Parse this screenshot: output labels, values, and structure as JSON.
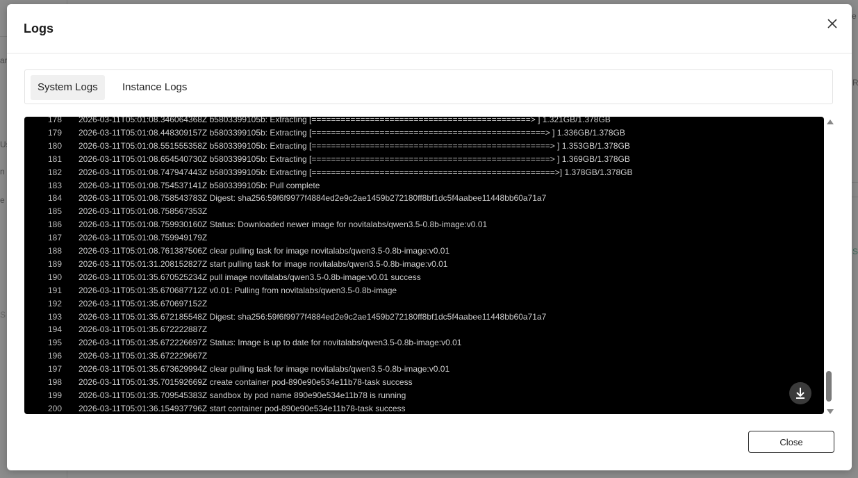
{
  "modal": {
    "title": "Logs",
    "close_icon": "close-icon"
  },
  "tabs": [
    {
      "label": "System Logs",
      "active": true
    },
    {
      "label": "Instance Logs",
      "active": false
    }
  ],
  "logs": [
    {
      "num": "178",
      "text": "2026-03-11T05:01:08.346064368Z b5803399105b: Extracting [=============================================> ] 1.321GB/1.378GB"
    },
    {
      "num": "179",
      "text": "2026-03-11T05:01:08.448309157Z b5803399105b: Extracting [================================================> ] 1.336GB/1.378GB"
    },
    {
      "num": "180",
      "text": "2026-03-11T05:01:08.551555358Z b5803399105b: Extracting [=================================================> ] 1.353GB/1.378GB"
    },
    {
      "num": "181",
      "text": "2026-03-11T05:01:08.654540730Z b5803399105b: Extracting [=================================================> ] 1.369GB/1.378GB"
    },
    {
      "num": "182",
      "text": "2026-03-11T05:01:08.747947443Z b5803399105b: Extracting [==================================================>] 1.378GB/1.378GB"
    },
    {
      "num": "183",
      "text": "2026-03-11T05:01:08.754537141Z b5803399105b: Pull complete"
    },
    {
      "num": "184",
      "text": "2026-03-11T05:01:08.758543783Z Digest: sha256:59f6f9977f4884ed2e9c2ae1459b272180ff8bf1dc5f4aabee11448bb60a71a7"
    },
    {
      "num": "185",
      "text": "2026-03-11T05:01:08.758567353Z"
    },
    {
      "num": "186",
      "text": "2026-03-11T05:01:08.759930160Z Status: Downloaded newer image for novitalabs/qwen3.5-0.8b-image:v0.01"
    },
    {
      "num": "187",
      "text": "2026-03-11T05:01:08.759949179Z"
    },
    {
      "num": "188",
      "text": "2026-03-11T05:01:08.761387506Z clear pulling task for image novitalabs/qwen3.5-0.8b-image:v0.01"
    },
    {
      "num": "189",
      "text": "2026-03-11T05:01:31.208152827Z start pulling task for image novitalabs/qwen3.5-0.8b-image:v0.01"
    },
    {
      "num": "190",
      "text": "2026-03-11T05:01:35.670525234Z pull image novitalabs/qwen3.5-0.8b-image:v0.01 success"
    },
    {
      "num": "191",
      "text": "2026-03-11T05:01:35.670687712Z v0.01: Pulling from novitalabs/qwen3.5-0.8b-image"
    },
    {
      "num": "192",
      "text": "2026-03-11T05:01:35.670697152Z"
    },
    {
      "num": "193",
      "text": "2026-03-11T05:01:35.672185548Z Digest: sha256:59f6f9977f4884ed2e9c2ae1459b272180ff8bf1dc5f4aabee11448bb60a71a7"
    },
    {
      "num": "194",
      "text": "2026-03-11T05:01:35.672222887Z"
    },
    {
      "num": "195",
      "text": "2026-03-11T05:01:35.672226697Z Status: Image is up to date for novitalabs/qwen3.5-0.8b-image:v0.01"
    },
    {
      "num": "196",
      "text": "2026-03-11T05:01:35.672229667Z"
    },
    {
      "num": "197",
      "text": "2026-03-11T05:01:35.673629994Z clear pulling task for image novitalabs/qwen3.5-0.8b-image:v0.01"
    },
    {
      "num": "198",
      "text": "2026-03-11T05:01:35.701592669Z create container pod-890e90e534e11b78-task success"
    },
    {
      "num": "199",
      "text": "2026-03-11T05:01:35.709545383Z sandbox by pod name 890e90e534e11b78 is running"
    },
    {
      "num": "200",
      "text": "2026-03-11T05:01:36.154937796Z start container pod-890e90e534e11b78-task success"
    }
  ],
  "footer": {
    "close_label": "Close"
  },
  "background": {
    "fragments": [
      "ar",
      "Us",
      "n",
      "e",
      "S",
      "e",
      "RU",
      "SC"
    ]
  },
  "icons": {
    "download": "download-icon",
    "scroll_up": "scroll-up-arrow-icon",
    "scroll_down": "scroll-down-arrow-icon"
  }
}
